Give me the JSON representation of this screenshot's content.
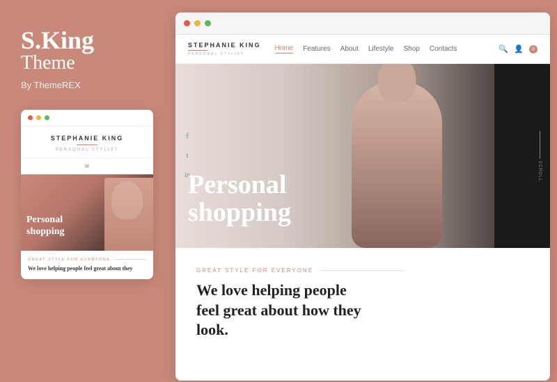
{
  "left": {
    "brand_name": "S.King",
    "brand_theme": "Theme",
    "brand_by": "By ThemeREX"
  },
  "mobile_preview": {
    "dots": [
      "red",
      "yellow",
      "green"
    ],
    "site_name": "STEPHANIE KING",
    "site_sub": "PERSONAL STYLIST",
    "hamburger": "≡",
    "hero_text_line1": "Personal",
    "hero_text_line2": "shopping",
    "tag": "GREAT STYLE FOR EVERYONE",
    "headline": "We love helping people feel great about they"
  },
  "browser": {
    "dots": [
      "red",
      "yellow",
      "green"
    ],
    "nav": {
      "logo_name": "STEPHANIE KING",
      "logo_sub": "PERSONAL STYLIST",
      "links": [
        "Home",
        "Features",
        "About",
        "Lifestyle",
        "Shop",
        "Contacts"
      ],
      "active_link": "Home"
    },
    "hero": {
      "text_line1": "Personal",
      "text_line2": "shopping"
    },
    "about": {
      "tag": "GREAT STYLE FOR EVERYONE",
      "headline_line1": "We love helping people",
      "headline_line2": "feel great about how they",
      "headline_line3": "look."
    }
  },
  "social_icons": [
    "f",
    "t",
    "in"
  ],
  "scroll_label": "SCROLL",
  "cart_count": "0"
}
